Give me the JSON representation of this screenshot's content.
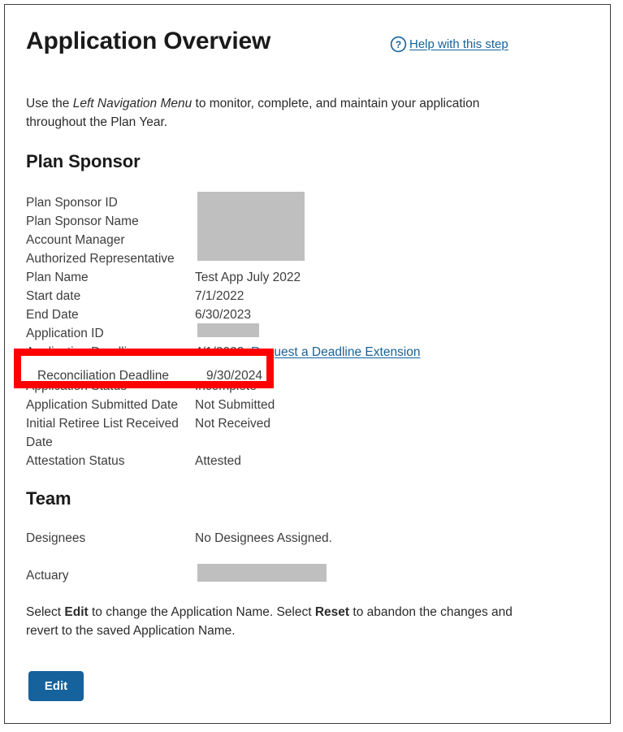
{
  "header": {
    "title": "Application Overview",
    "help_link_label": "Help with this step",
    "help_icon": "question-mark-circle-icon",
    "link_color": "#15629c"
  },
  "intro": {
    "prefix": "Use the ",
    "emphasis": "Left Navigation Menu",
    "suffix": " to monitor, complete, and maintain your application throughout the Plan Year."
  },
  "plan_sponsor": {
    "heading": "Plan Sponsor",
    "rows": [
      {
        "label": "Plan Sponsor ID",
        "value": "",
        "redacted": true
      },
      {
        "label": "Plan Sponsor Name",
        "value": "",
        "redacted": true
      },
      {
        "label": "Account Manager",
        "value": "",
        "redacted": true
      },
      {
        "label": "Authorized Representative",
        "value": "",
        "redacted": true
      },
      {
        "label": "Plan Name",
        "value": "Test App July 2022",
        "redacted": false
      },
      {
        "label": "Start date",
        "value": "7/1/2022",
        "redacted": false
      },
      {
        "label": "End Date",
        "value": "6/30/2023",
        "redacted": false
      },
      {
        "label": "Application ID",
        "value": "",
        "redacted": true
      },
      {
        "label": "Application Deadline",
        "value": "4/1/2023",
        "link_label": "Request a Deadline Extension",
        "redacted": false
      },
      {
        "label": "Application Status",
        "value": "Incomplete",
        "redacted": false
      },
      {
        "label": "Application Submitted Date",
        "value": "Not Submitted",
        "redacted": false
      },
      {
        "label": "Initial Retiree List Received Date",
        "value": "Not Received",
        "redacted": false
      },
      {
        "label": "Attestation Status",
        "value": "Attested",
        "redacted": false
      }
    ]
  },
  "annotation": {
    "label": "Reconciliation Deadline",
    "value": "9/30/2024",
    "box_color": "#fe0000"
  },
  "team": {
    "heading": "Team",
    "rows": [
      {
        "label": "Designees",
        "value": "No Designees Assigned.",
        "redacted": false
      },
      {
        "label": "Actuary",
        "value": "",
        "redacted": true
      }
    ]
  },
  "footer_note": {
    "part1": "Select ",
    "bold1": "Edit",
    "part2": " to change the Application Name. Select ",
    "bold2": "Reset",
    "part3": " to abandon the changes and revert to the saved Application Name."
  },
  "actions": {
    "edit_label": "Edit",
    "button_color": "#15629c"
  }
}
